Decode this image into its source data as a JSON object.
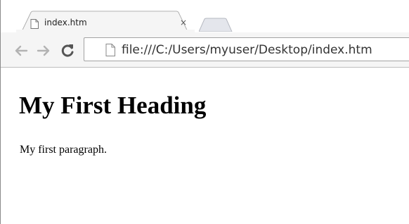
{
  "browser": {
    "tab": {
      "title": "index.htm",
      "close_glyph": "×",
      "icon": "page-icon"
    },
    "toolbar": {
      "back_icon": "arrow-left-icon",
      "forward_icon": "arrow-right-icon",
      "reload_icon": "reload-icon",
      "address": "file:///C:/Users/myuser/Desktop/index.htm",
      "address_icon": "page-icon"
    }
  },
  "page": {
    "heading": "My First Heading",
    "paragraph": "My first paragraph."
  },
  "colors": {
    "toolbar_bg": "#f5f5f5",
    "tab_border": "#a9a9a9",
    "icon_gray": "#8c8c8c"
  }
}
